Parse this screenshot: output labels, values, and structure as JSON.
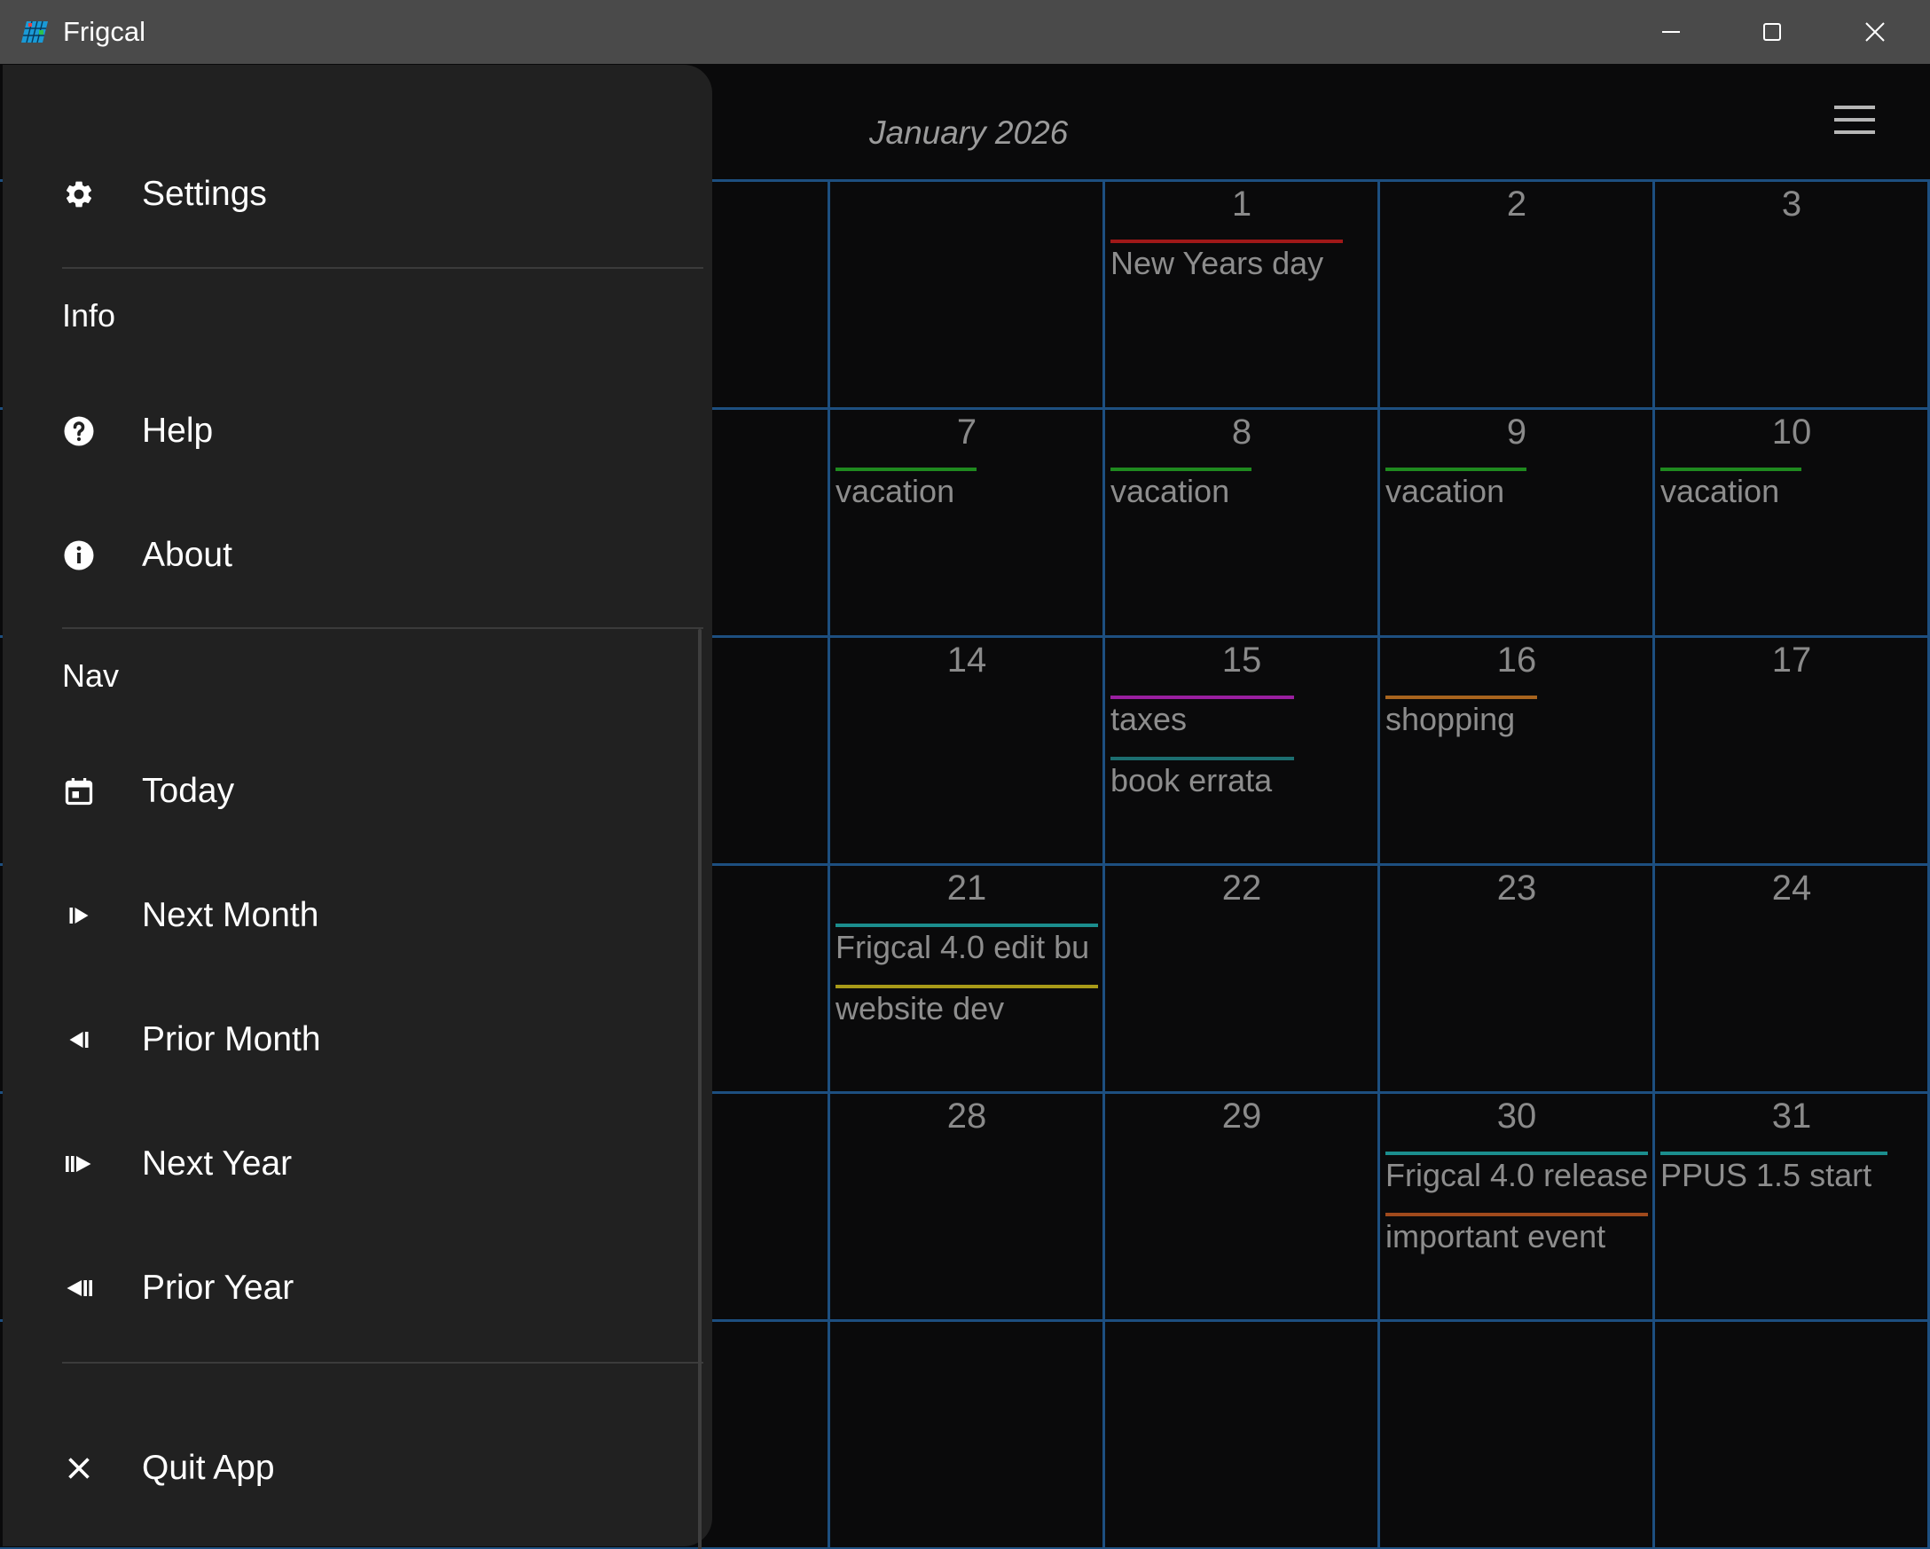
{
  "window": {
    "title": "Frigcal",
    "minimize_icon": "minimize-icon",
    "maximize_icon": "maximize-icon",
    "close_icon": "close-icon"
  },
  "calendar": {
    "month_title": "January 2026",
    "menu_icon": "hamburger-menu-icon",
    "days": [
      {
        "num": "1",
        "row": 0,
        "col": 2
      },
      {
        "num": "2",
        "row": 0,
        "col": 3
      },
      {
        "num": "3",
        "row": 0,
        "col": 4
      },
      {
        "num": "7",
        "row": 1,
        "col": 1
      },
      {
        "num": "8",
        "row": 1,
        "col": 2
      },
      {
        "num": "9",
        "row": 1,
        "col": 3
      },
      {
        "num": "10",
        "row": 1,
        "col": 4
      },
      {
        "num": "14",
        "row": 2,
        "col": 1
      },
      {
        "num": "15",
        "row": 2,
        "col": 2
      },
      {
        "num": "16",
        "row": 2,
        "col": 3
      },
      {
        "num": "17",
        "row": 2,
        "col": 4
      },
      {
        "num": "21",
        "row": 3,
        "col": 1
      },
      {
        "num": "22",
        "row": 3,
        "col": 2
      },
      {
        "num": "23",
        "row": 3,
        "col": 3
      },
      {
        "num": "24",
        "row": 3,
        "col": 4
      },
      {
        "num": "28",
        "row": 4,
        "col": 1
      },
      {
        "num": "29",
        "row": 4,
        "col": 2
      },
      {
        "num": "30",
        "row": 4,
        "col": 3
      },
      {
        "num": "31",
        "row": 4,
        "col": 4
      }
    ],
    "events": [
      {
        "label": "New Years day",
        "row": 0,
        "col": 2,
        "slot": 0,
        "color": "#a01818",
        "bar": 0.86
      },
      {
        "label": "vacation",
        "row": 1,
        "col": 1,
        "slot": 0,
        "color": "#1f8a1f",
        "bar": 0.52
      },
      {
        "label": "vacation",
        "row": 1,
        "col": 2,
        "slot": 0,
        "color": "#1f8a1f",
        "bar": 0.52
      },
      {
        "label": "vacation",
        "row": 1,
        "col": 3,
        "slot": 0,
        "color": "#1f8a1f",
        "bar": 0.52
      },
      {
        "label": "vacation",
        "row": 1,
        "col": 4,
        "slot": 0,
        "color": "#1f8a1f",
        "bar": 0.52
      },
      {
        "label": "taxes",
        "row": 2,
        "col": 2,
        "slot": 0,
        "color": "#9a1fa0",
        "bar": 0.68
      },
      {
        "label": "book errata",
        "row": 2,
        "col": 2,
        "slot": 1,
        "color": "#1c6e70",
        "bar": 0.68
      },
      {
        "label": "shopping",
        "row": 2,
        "col": 3,
        "slot": 0,
        "color": "#a8641e",
        "bar": 0.56
      },
      {
        "label": "Frigcal 4.0  edit bu",
        "row": 3,
        "col": 1,
        "slot": 0,
        "color": "#1b8e8e",
        "bar": 0.97
      },
      {
        "label": "website dev",
        "row": 3,
        "col": 1,
        "slot": 1,
        "color": "#a89a18",
        "bar": 0.97
      },
      {
        "label": "Frigcal 4.0 release",
        "row": 4,
        "col": 3,
        "slot": 0,
        "color": "#1b8e8e",
        "bar": 0.97
      },
      {
        "label": "important event",
        "row": 4,
        "col": 3,
        "slot": 1,
        "color": "#a04a1c",
        "bar": 0.97
      },
      {
        "label": "PPUS 1.5 start",
        "row": 4,
        "col": 4,
        "slot": 0,
        "color": "#1b8e8e",
        "bar": 0.84
      }
    ]
  },
  "drawer": {
    "settings": {
      "label": "Settings",
      "icon": "gear-icon"
    },
    "info_heading": "Info",
    "help": {
      "label": "Help",
      "icon": "help-circle-icon"
    },
    "about": {
      "label": "About",
      "icon": "info-circle-icon"
    },
    "nav_heading": "Nav",
    "today": {
      "label": "Today",
      "icon": "calendar-today-icon"
    },
    "next_month": {
      "label": "Next Month",
      "icon": "skip-next-icon"
    },
    "prior_month": {
      "label": "Prior Month",
      "icon": "skip-previous-icon"
    },
    "next_year": {
      "label": "Next Year",
      "icon": "double-skip-next-icon"
    },
    "prior_year": {
      "label": "Prior Year",
      "icon": "double-skip-previous-icon"
    },
    "quit": {
      "label": "Quit App",
      "icon": "close-icon"
    }
  }
}
